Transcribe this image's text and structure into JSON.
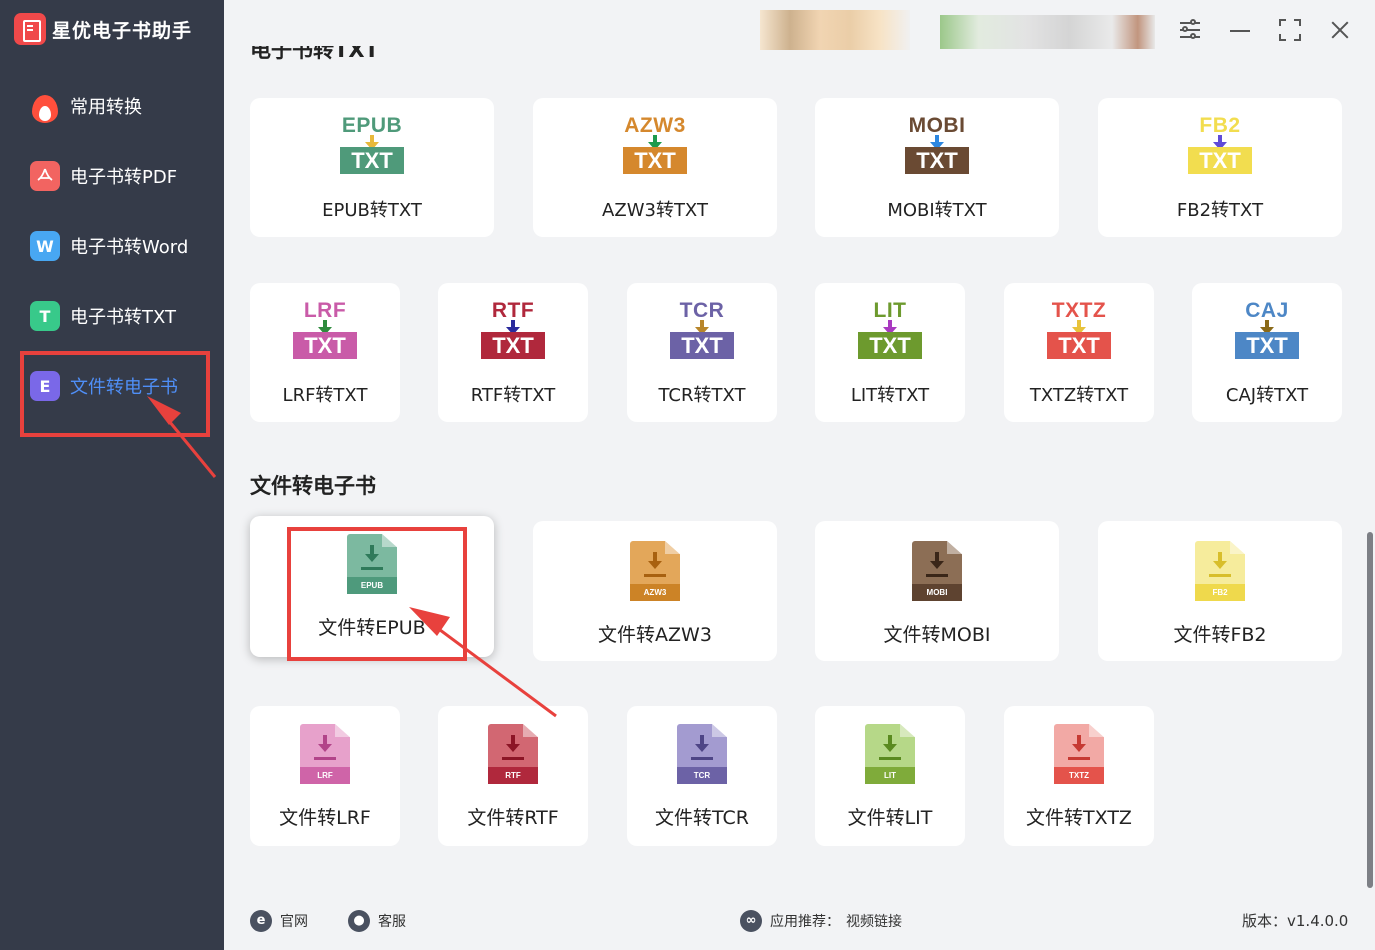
{
  "app": {
    "title": "星优电子书助手"
  },
  "sidebar": {
    "items": [
      {
        "label": "常用转换"
      },
      {
        "label": "电子书转PDF",
        "icon_text": "PDF"
      },
      {
        "label": "电子书转Word",
        "icon_text": "W"
      },
      {
        "label": "电子书转TXT",
        "icon_text": "T"
      },
      {
        "label": "文件转电子书",
        "icon_text": "E"
      }
    ]
  },
  "sections": {
    "ebook_to_txt_title": "电子书转TXT",
    "file_to_ebook_title": "文件转电子书"
  },
  "to_txt_cards": [
    {
      "fmt": "EPUB",
      "label": "EPUB转TXT",
      "color": "#4f9a7a",
      "arrow": "#e8b93b"
    },
    {
      "fmt": "AZW3",
      "label": "AZW3转TXT",
      "color": "#d5882d",
      "arrow": "#1d9a4d"
    },
    {
      "fmt": "MOBI",
      "label": "MOBI转TXT",
      "color": "#6a4a33",
      "arrow": "#2d87e0"
    },
    {
      "fmt": "FB2",
      "label": "FB2转TXT",
      "color": "#f2dd4f",
      "arrow": "#5f4bd8"
    },
    {
      "fmt": "LRF",
      "label": "LRF转TXT",
      "color": "#c95ba8",
      "arrow": "#2e8b3d"
    },
    {
      "fmt": "RTF",
      "label": "RTF转TXT",
      "color": "#b0283c",
      "arrow": "#2a2a9c"
    },
    {
      "fmt": "TCR",
      "label": "TCR转TXT",
      "color": "#6c62a6",
      "arrow": "#b8862b"
    },
    {
      "fmt": "LIT",
      "label": "LIT转TXT",
      "color": "#6d9a2e",
      "arrow": "#a93ac0"
    },
    {
      "fmt": "TXTZ",
      "label": "TXTZ转TXT",
      "color": "#e4534b",
      "arrow": "#e8c33b"
    },
    {
      "fmt": "CAJ",
      "label": "CAJ转TXT",
      "color": "#4d87c6",
      "arrow": "#8a6a19"
    }
  ],
  "to_ebook_cards": [
    {
      "fmt": "EPUB",
      "label": "文件转EPUB",
      "color": "#7cb9a0",
      "band": "#4e9a7c",
      "dl": "#2f7a5a"
    },
    {
      "fmt": "AZW3",
      "label": "文件转AZW3",
      "color": "#e3a75a",
      "band": "#cc8326",
      "dl": "#a86110"
    },
    {
      "fmt": "MOBI",
      "label": "文件转MOBI",
      "color": "#8c6e55",
      "band": "#5e4330",
      "dl": "#3a2618"
    },
    {
      "fmt": "FB2",
      "label": "文件转FB2",
      "color": "#f6ec9c",
      "band": "#efd94c",
      "dl": "#d8be2b"
    },
    {
      "fmt": "LRF",
      "label": "文件转LRF",
      "color": "#e7a1cb",
      "band": "#cf64a8",
      "dl": "#b24489"
    },
    {
      "fmt": "RTF",
      "label": "文件转RTF",
      "color": "#d26772",
      "band": "#b0283c",
      "dl": "#8c1526"
    },
    {
      "fmt": "TCR",
      "label": "文件转TCR",
      "color": "#a39bd0",
      "band": "#6c62a6",
      "dl": "#4e4586"
    },
    {
      "fmt": "LIT",
      "label": "文件转LIT",
      "color": "#b6d888",
      "band": "#7fab3a",
      "dl": "#5a8a1f"
    },
    {
      "fmt": "TXTZ",
      "label": "文件转TXTZ",
      "color": "#f2a9a5",
      "band": "#e4534b",
      "dl": "#c63a33"
    }
  ],
  "footer": {
    "website": "官网",
    "service": "客服",
    "recommend_label": "应用推荐：",
    "recommend_link": "视频链接",
    "version": "版本：v1.4.0.0"
  },
  "colors": {
    "sidebar_bg": "#353b49",
    "accent": "#4f8ff7",
    "annotation_red": "#e8413d"
  }
}
